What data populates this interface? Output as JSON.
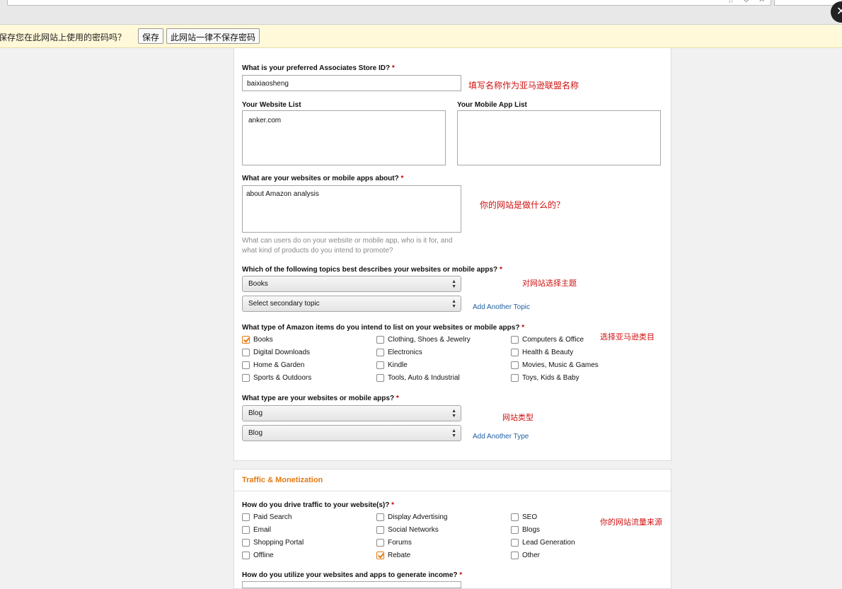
{
  "password_bar": {
    "message": "要保存您在此网站上使用的密码吗？",
    "save_label": "保存",
    "never_label": "此网站一律不保存密码"
  },
  "profile": {
    "store_id_label": "What is your preferred Associates Store ID?",
    "store_id_value": "baixiaosheng",
    "website_list_label": "Your Website List",
    "website_list_value": "anker.com",
    "app_list_label": "Your Mobile App List",
    "about_label": "What are your websites or mobile apps about?",
    "about_value": "about Amazon analysis",
    "about_help": "What can users do on your website or mobile app, who is it for, and what kind of products do you intend to promote?",
    "topics_label": "Which of the following topics best describes your websites or mobile apps?",
    "topic_primary": "Books",
    "topic_secondary": "Select secondary topic",
    "add_topic": "Add Another Topic",
    "items_label": "What type of Amazon items do you intend to list on your websites or mobile apps?",
    "items": [
      {
        "label": "Books",
        "checked": true
      },
      {
        "label": "Clothing, Shoes & Jewelry",
        "checked": false
      },
      {
        "label": "Computers & Office",
        "checked": false
      },
      {
        "label": "Digital Downloads",
        "checked": false
      },
      {
        "label": "Electronics",
        "checked": false
      },
      {
        "label": "Health & Beauty",
        "checked": false
      },
      {
        "label": "Home & Garden",
        "checked": false
      },
      {
        "label": "Kindle",
        "checked": false
      },
      {
        "label": "Movies, Music & Games",
        "checked": false
      },
      {
        "label": "Sports & Outdoors",
        "checked": false
      },
      {
        "label": "Tools, Auto & Industrial",
        "checked": false
      },
      {
        "label": "Toys, Kids & Baby",
        "checked": false
      }
    ],
    "site_type_label": "What type are your websites or mobile apps?",
    "site_type_1": "Blog",
    "site_type_2": "Blog",
    "add_type": "Add Another Type"
  },
  "traffic": {
    "section_title": "Traffic & Monetization",
    "drive_label": "How do you drive traffic to your website(s)?",
    "options": [
      {
        "label": "Paid Search",
        "checked": false
      },
      {
        "label": "Display Advertising",
        "checked": false
      },
      {
        "label": "SEO",
        "checked": false
      },
      {
        "label": "Email",
        "checked": false
      },
      {
        "label": "Social Networks",
        "checked": false
      },
      {
        "label": "Blogs",
        "checked": false
      },
      {
        "label": "Shopping Portal",
        "checked": false
      },
      {
        "label": "Forums",
        "checked": false
      },
      {
        "label": "Lead Generation",
        "checked": false
      },
      {
        "label": "Offline",
        "checked": false
      },
      {
        "label": "Rebate",
        "checked": true
      },
      {
        "label": "Other",
        "checked": false
      }
    ],
    "income_label": "How do you utilize your websites and apps to generate income?"
  },
  "annotations": {
    "store_id_note": "填写名称作为亚马逊联盟名称",
    "about_note": "你的网站是做什么的？",
    "topic_note": "对网站选择主题",
    "items_note": "选择亚马逊类目",
    "type_note": "网站类型",
    "traffic_note": "你的网站流量来源"
  },
  "colors": {
    "accent": "#e47911",
    "link": "#1f5f9f",
    "note_red": "#d01010",
    "required": "#c40000"
  }
}
